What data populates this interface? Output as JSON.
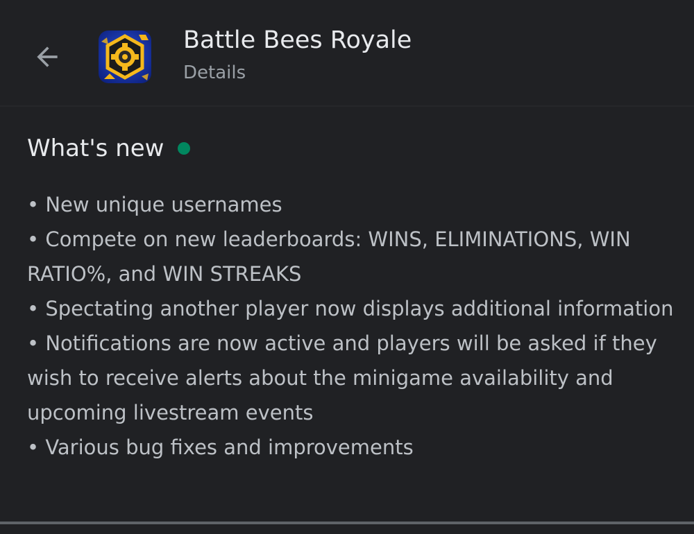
{
  "header": {
    "back_icon": "arrow-left-icon",
    "app_icon": "battle-bees-app-icon",
    "title": "Battle Bees Royale",
    "subtitle": "Details"
  },
  "whats_new": {
    "title": "What's new",
    "new_indicator_color": "#01875f",
    "items": [
      "• New unique usernames",
      "• Compete on new leaderboards: WINS, ELIMINATIONS, WIN RATIO%, and WIN STREAKS",
      "• Spectating another player now displays additional information",
      "• Notifications are now active and players will be asked if they wish to receive alerts about the minigame availability and upcoming livestream events",
      "• Various bug fixes and improvements"
    ]
  }
}
